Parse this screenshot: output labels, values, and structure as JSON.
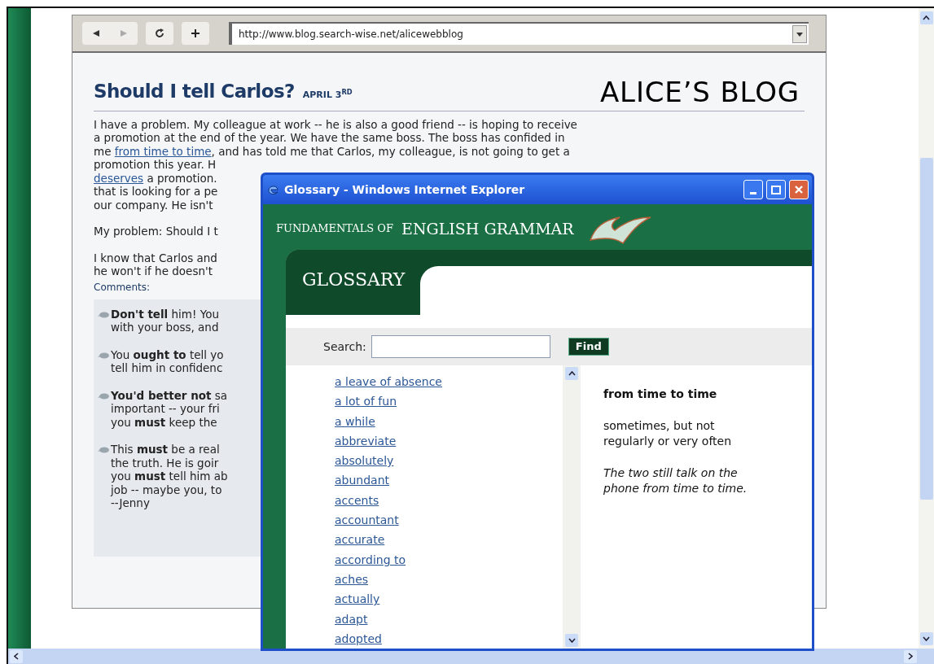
{
  "browser": {
    "url": "http://www.blog.search-wise.net/alicewebblog"
  },
  "blog": {
    "post_title": "Should I tell Carlos?",
    "date": "APRIL 3$^{RD}$",
    "blog_title": "ALICE’S BLOG",
    "paragraphs": [
      [
        [
          {
            "kind": "text",
            "text": "I have a problem. My colleague at work -- he is also a good friend -- is hoping to receive"
          }
        ],
        [
          {
            "kind": "text",
            "text": "a promotion at the end of the year. We have the same boss. The boss has confided in"
          }
        ],
        [
          {
            "kind": "text",
            "text": "me "
          },
          {
            "kind": "link",
            "text": "from time to time"
          },
          {
            "kind": "text",
            "text": ", and has told me that Carlos, my colleague, is not going to get a"
          }
        ],
        [
          {
            "kind": "text",
            "text": "promotion this year. H"
          }
        ],
        [
          {
            "kind": "link",
            "text": "deserves"
          },
          {
            "kind": "text",
            "text": " a promotion."
          }
        ],
        [
          {
            "kind": "text",
            "text": "that is looking for a pe"
          }
        ],
        [
          {
            "kind": "text",
            "text": "our company. He isn't"
          }
        ]
      ],
      [
        [
          {
            "kind": "text",
            "text": "My problem: Should I t"
          }
        ]
      ],
      [
        [
          {
            "kind": "text",
            "text": "I know that Carlos and"
          }
        ],
        [
          {
            "kind": "text",
            "text": "he won't if he doesn't"
          }
        ]
      ]
    ],
    "comments_label": "Comments:",
    "comments": [
      [
        "**Don't tell** him! You",
        "with your boss, and"
      ],
      [
        "You **ought to** tell yo",
        "tell him in confidenc"
      ],
      [
        "**You'd better not** sa",
        "important -- your fri",
        "you **must** keep the"
      ],
      [
        "This **must** be a real",
        "the truth. He is goir",
        "you **must** tell him ab",
        "job -- maybe you, to",
        "--Jenny"
      ]
    ]
  },
  "popup": {
    "title": "Glossary - Windows Internet Explorer",
    "brand_small": "FUNDAMENTALS OF",
    "brand_large": "ENGLISH GRAMMAR",
    "section_title": "GLOSSARY",
    "search_label": "Search:",
    "find_button": "Find",
    "terms": [
      "a leave of absence",
      "a lot of fun",
      "a while",
      "abbreviate",
      "absolutely",
      "abundant",
      "accents",
      "accountant",
      "accurate",
      "according to",
      "aches",
      "actually",
      "adapt",
      "adopted"
    ],
    "definition": {
      "term": "from time to time",
      "meaning": "sometimes, but not regularly or very often",
      "example": "The two still talk on the phone from time to time."
    }
  }
}
